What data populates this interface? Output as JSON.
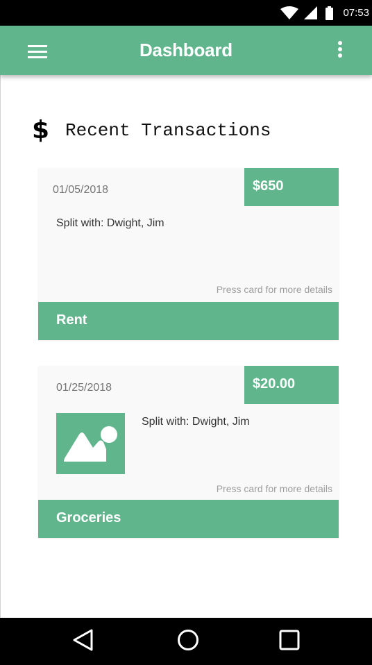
{
  "status_bar": {
    "time": "07:53",
    "icons": [
      "wifi-icon",
      "cell-signal-icon",
      "battery-icon"
    ]
  },
  "app_bar": {
    "title": "Dashboard",
    "menu_icon": "hamburger-menu-icon",
    "overflow_icon": "more-vert-icon"
  },
  "section": {
    "icon": "dollar-icon",
    "icon_glyph": "$",
    "title": "Recent Transactions"
  },
  "transactions": [
    {
      "date": "01/05/2018",
      "amount": "$650",
      "split": "Split with: Dwight, Jim",
      "hint": "Press card for more details",
      "category": "Rent",
      "has_image": false
    },
    {
      "date": "01/25/2018",
      "amount": "$20.00",
      "split": "Split with: Dwight, Jim",
      "hint": "Press card for more details",
      "category": "Groceries",
      "has_image": true,
      "image_icon": "image-placeholder-icon"
    }
  ],
  "nav_bar": {
    "buttons": [
      "back-icon",
      "home-icon",
      "recents-icon"
    ]
  },
  "colors": {
    "accent": "#60b58d",
    "card_background": "#f9f9f9",
    "status_bar": "#000000",
    "nav_bar": "#000000"
  }
}
